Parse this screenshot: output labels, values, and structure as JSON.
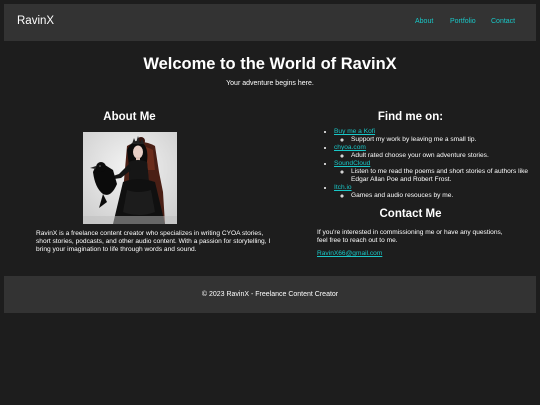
{
  "nav": {
    "brand": "RavinX",
    "links": [
      {
        "label": "About"
      },
      {
        "label": "Portfolio"
      },
      {
        "label": "Contact"
      }
    ]
  },
  "hero": {
    "title": "Welcome to the World of RavinX",
    "subtitle": "Your adventure begins here."
  },
  "about": {
    "heading": "About Me",
    "portrait_icon": "gothic-queen-portrait",
    "text": "RavinX is a freelance content creator who specializes in writing CYOA stories, short stories, podcasts, and other audio content. With a passion for storytelling, I bring your imagination to life through words and sound."
  },
  "find": {
    "heading": "Find me on:",
    "items": [
      {
        "label": "Buy me a Kofi",
        "desc": "Support my work by leaving me a small tip."
      },
      {
        "label": "chyoa.com",
        "desc": "Adult rated choose your own adventure stories."
      },
      {
        "label": "SoundCloud",
        "desc": "Listen to me read the poems and short stories of authors like Edgar Allan Poe and Robert Frost."
      },
      {
        "label": "Itch.io",
        "desc": "Games and audio resouces by me."
      }
    ]
  },
  "contact": {
    "heading": "Contact Me",
    "text": "If you're interested in commissioning me or have any questions, feel free to reach out to me.",
    "email": "RavinX66@gmail.com"
  },
  "footer": {
    "text": "© 2023 RavinX - Freelance Content Creator"
  },
  "colors": {
    "background": "#1d1d1d",
    "bar": "#333333",
    "link": "#19c8c8",
    "text": "#ffffff"
  }
}
